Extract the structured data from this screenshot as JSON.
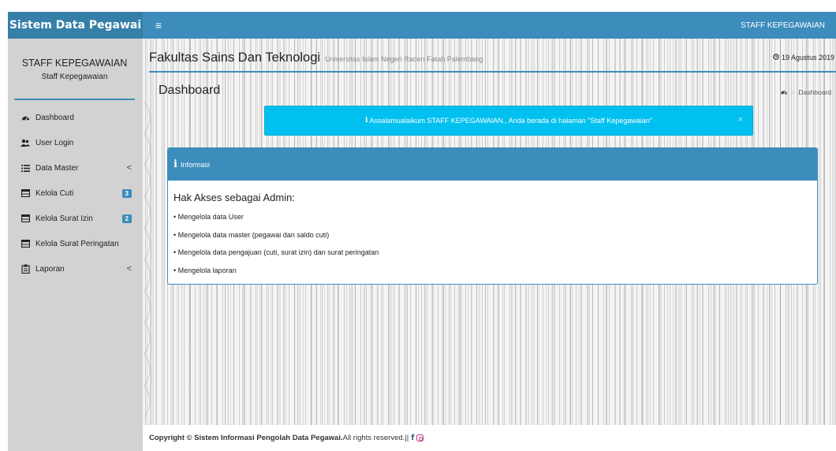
{
  "topbar": {
    "brand": "Sistem Data Pegawai",
    "toggle_icon": "bars-icon",
    "user_label": "STAFF KEPEGAWAIAN"
  },
  "sidebar": {
    "user_name": "STAFF KEPEGAWAIAN",
    "user_role": "Staff Kepegawaian",
    "items": [
      {
        "label": "Dashboard",
        "icon": "dashboard-icon"
      },
      {
        "label": "User Login",
        "icon": "users-icon"
      },
      {
        "label": "Data Master",
        "icon": "list-icon",
        "arrow": "<"
      },
      {
        "label": "Kelola Cuti",
        "icon": "table-icon",
        "badge": "3"
      },
      {
        "label": "Kelola Surat Izin",
        "icon": "table-icon",
        "badge": "2"
      },
      {
        "label": "Kelola Surat Peringatan",
        "icon": "table-icon"
      },
      {
        "label": "Laporan",
        "icon": "clipboard-icon",
        "arrow": "<"
      }
    ]
  },
  "header": {
    "faculty": "Fakultas Sains Dan Teknologi",
    "university": "Universitas Islam Negeri Raden Fatah Palembang",
    "date": "19 Agustus 2019"
  },
  "page": {
    "title": "Dashboard",
    "breadcrumb": "Dashboard"
  },
  "alert": {
    "icon": "i",
    "text": "Assalamualaikum STAFF KEPEGAWAIAN., Anda berada di halaman \"Staff Kepegawaian\"",
    "close": "×"
  },
  "info": {
    "icon": "i",
    "title": "Informasi",
    "heading": "Hak Akses sebagai Admin:",
    "items": [
      "• Mengelola data User",
      "• Mengelola data master (pegawai dan saldo cuti)",
      "• Mengelola data pengajuan (cuti, surat izin) dan surat peringatan",
      "• Mengelola laporan"
    ]
  },
  "footer": {
    "prefix": "Copyright © Sistem Informasi Pengolah Data Pegawai.",
    "suffix": " All rights reserved.||",
    "fb": "f"
  },
  "colors": {
    "primary": "#3c8dbc",
    "primary_dark": "#367fa9",
    "alert": "#00c0ef",
    "sidebar": "#d2d2d2"
  }
}
